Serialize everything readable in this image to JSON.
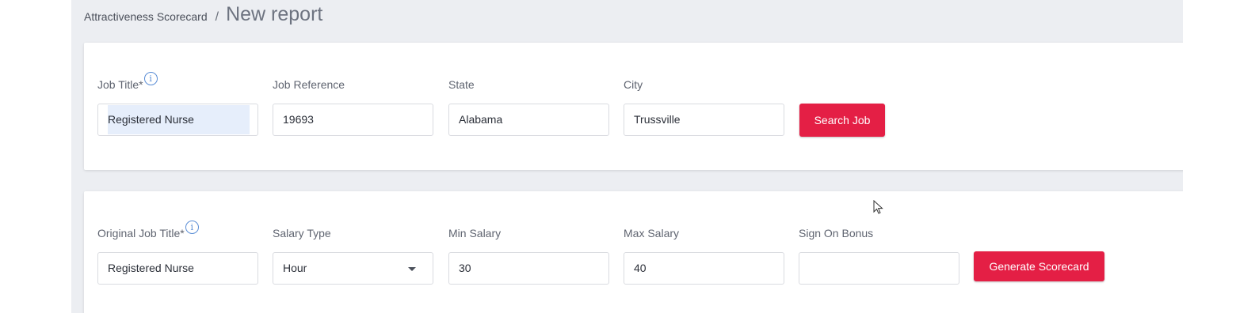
{
  "breadcrumb": {
    "parent": "Attractiveness Scorecard",
    "separator": "/",
    "current": "New report"
  },
  "search_card": {
    "job_title": {
      "label": "Job Title*",
      "value": "Registered Nurse"
    },
    "job_reference": {
      "label": "Job Reference",
      "value": "19693"
    },
    "state": {
      "label": "State",
      "value": "Alabama"
    },
    "city": {
      "label": "City",
      "value": "Trussville"
    },
    "search_button": "Search Job"
  },
  "details_card": {
    "original_job_title": {
      "label": "Original Job Title*",
      "value": "Registered Nurse"
    },
    "salary_type": {
      "label": "Salary Type",
      "value": "Hour"
    },
    "min_salary": {
      "label": "Min Salary",
      "value": "30"
    },
    "max_salary": {
      "label": "Max Salary",
      "value": "40"
    },
    "sign_on_bonus": {
      "label": "Sign On Bonus",
      "value": ""
    },
    "generate_button": "Generate Scorecard"
  },
  "icons": {
    "info": "info-icon",
    "dropdown": "chevron-down-icon",
    "cursor": "mouse-pointer-icon"
  },
  "colors": {
    "accent": "#e41f45",
    "info": "#5b8ed6",
    "background": "#eceef2"
  }
}
